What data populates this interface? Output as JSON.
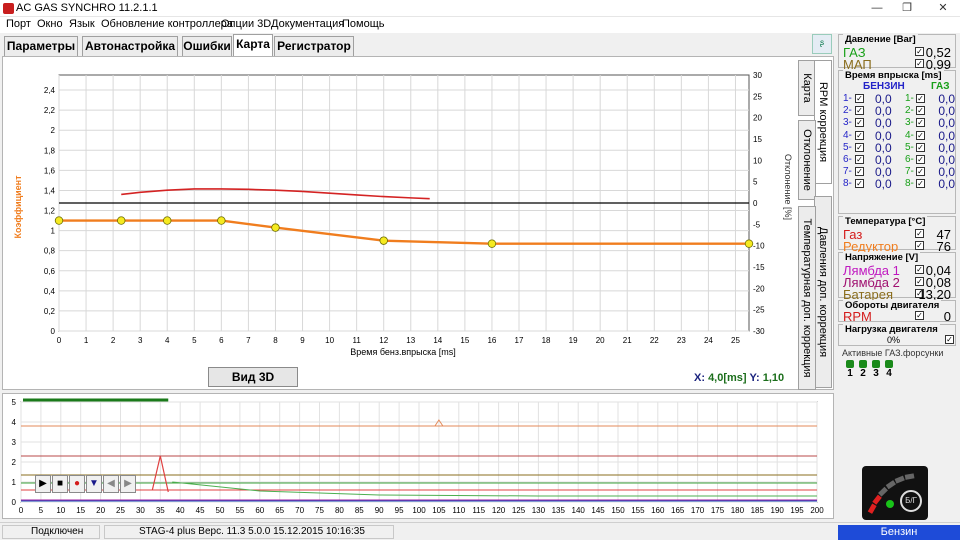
{
  "window": {
    "title": "AC GAS SYNCHRO  11.2.1.1",
    "minimize": "—",
    "maximize": "❐",
    "close": "✕"
  },
  "menu": [
    "Порт",
    "Окно",
    "Язык",
    "Обновление контроллера",
    "Опции 3D",
    "Документация",
    "Помощь"
  ],
  "tabs": [
    "Параметры",
    "Автонастройка",
    "Ошибки",
    "Карта",
    "Регистратор"
  ],
  "active_tab": "Карта",
  "side_tabs": [
    "Карта",
    "RPM коррекция",
    "Отклонение",
    "Давления доп. коррекция",
    "Температурная доп. коррекция"
  ],
  "chart_data": {
    "type": "line",
    "xlabel": "Время бенз.впрыска [ms]",
    "ylabel_left": "Коэффициент",
    "ylabel_right": "Отклонение [%]",
    "xlim": [
      0,
      25.5
    ],
    "ylim_left": [
      0,
      2.55
    ],
    "ylim_right": [
      -30,
      30
    ],
    "x_ticks": [
      0,
      1,
      2,
      3,
      4,
      5,
      6,
      7,
      8,
      9,
      10,
      11,
      12,
      13,
      14,
      15,
      16,
      17,
      18,
      19,
      20,
      21,
      22,
      23,
      24,
      25
    ],
    "y_ticks_left": [
      "0",
      "0,2",
      "0,4",
      "0,6",
      "0,8",
      "1",
      "1,2",
      "1,4",
      "1,6",
      "1,8",
      "2",
      "2,2",
      "2,4"
    ],
    "y_ticks_right": [
      30,
      25,
      20,
      15,
      10,
      5,
      0,
      -5,
      -10,
      -15,
      -20,
      -25,
      -30
    ],
    "series": [
      {
        "name": "Коэффициент",
        "color": "#f07d1e",
        "x": [
          0,
          2.3,
          4,
          6,
          8,
          12,
          16,
          25.5
        ],
        "y": [
          1.1,
          1.1,
          1.1,
          1.1,
          1.03,
          0.9,
          0.87,
          0.87
        ],
        "points": [
          0,
          2.3,
          4,
          6,
          8,
          12,
          16,
          25.5
        ]
      },
      {
        "name": "Отклонение",
        "color": "#d42323",
        "x": [
          2.3,
          3,
          4,
          5,
          6,
          7,
          8,
          9,
          10,
          11,
          12,
          13,
          13.7
        ],
        "y": [
          2,
          2.5,
          3,
          3.3,
          3.3,
          3.2,
          3,
          2.7,
          2.3,
          1.9,
          1.5,
          1.2,
          1.0
        ]
      }
    ]
  },
  "readout": {
    "x_label": "X:",
    "x_value": "4,0[ms]",
    "y_label": "Y:",
    "y_value": "1,10"
  },
  "view_3d": "Вид 3D",
  "osc": {
    "y_ticks": [
      "0",
      "1",
      "2",
      "3",
      "4",
      "5"
    ],
    "x_ticks": [
      0,
      5,
      10,
      15,
      20,
      25,
      30,
      35,
      40,
      45,
      50,
      55,
      60,
      65,
      70,
      75,
      80,
      85,
      90,
      95,
      100,
      105,
      110,
      115,
      120,
      125,
      130,
      135,
      140,
      145,
      150,
      155,
      160,
      165,
      170,
      175,
      180,
      185,
      190,
      195,
      200
    ]
  },
  "right_panel": {
    "pressure": {
      "title": "Давление [Bar]",
      "gas_label": "ГАЗ",
      "gas_value": "0,52",
      "map_label": "МАП",
      "map_value": "0,99"
    },
    "injection": {
      "title": "Время впрыска [ms]",
      "petrol_header": "БЕНЗИН",
      "gas_header": "ГАЗ",
      "rows": [
        {
          "n": "1",
          "petrol": "0,0",
          "gas": "0,0"
        },
        {
          "n": "2",
          "petrol": "0,0",
          "gas": "0,0"
        },
        {
          "n": "3",
          "petrol": "0,0",
          "gas": "0,0"
        },
        {
          "n": "4",
          "petrol": "0,0",
          "gas": "0,0"
        },
        {
          "n": "5",
          "petrol": "0,0",
          "gas": "0,0"
        },
        {
          "n": "6",
          "petrol": "0,0",
          "gas": "0,0"
        },
        {
          "n": "7",
          "petrol": "0,0",
          "gas": "0,0"
        },
        {
          "n": "8",
          "petrol": "0,0",
          "gas": "0,0"
        }
      ]
    },
    "temperature": {
      "title": "Температура [°C]",
      "gas_label": "Газ",
      "gas_value": "47",
      "reducer_label": "Редуктор",
      "reducer_value": "76"
    },
    "voltage": {
      "title": "Напряжение [V]",
      "lambda1_label": "Лямбда 1",
      "lambda1_value": "0,04",
      "lambda2_label": "Лямбда 2",
      "lambda2_value": "0,08",
      "battery_label": "Батарея",
      "battery_value": "13,20"
    },
    "rpm": {
      "title": "Обороты двигателя",
      "label": "RPM",
      "value": "0"
    },
    "load": {
      "title": "Нагрузка двигателя",
      "value": "0%"
    },
    "injectors": {
      "title": "Активные ГАЗ.форсунки",
      "numbers": [
        "1",
        "2",
        "3",
        "4"
      ]
    },
    "fuel_mode": "Бензин",
    "fuel_switch": "Б/Г"
  },
  "status": {
    "connection": "Подключен",
    "device": "STAG-4 plus  Верс. 11.3  5.0.0    15.12.2015 10:16:35"
  },
  "colors": {
    "petrol_num": "#2424c8",
    "gas_num": "#18a018",
    "battery": "#8a6d1d",
    "lambda": "#c018c0",
    "red_label": "#d41c1c",
    "orange_label": "#f07d1e"
  }
}
